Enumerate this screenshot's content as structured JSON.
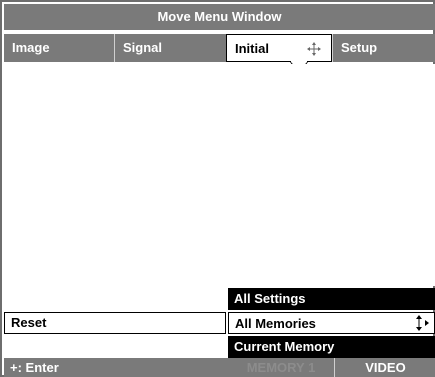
{
  "window": {
    "title": "Move Menu Window"
  },
  "tabs": [
    {
      "label": "Image"
    },
    {
      "label": "Signal"
    },
    {
      "label": "Initial"
    },
    {
      "label": "Setup"
    }
  ],
  "reset": {
    "label": "Reset"
  },
  "dropdown": {
    "options": [
      "All Settings",
      "All Memories",
      "Current Memory"
    ],
    "selected": "All Memories"
  },
  "status": {
    "enter_hint": "+: Enter",
    "memory": "MEMORY 1",
    "source": "VIDEO"
  },
  "colors": {
    "bar": "#7a7a7a",
    "highlight": "#000000",
    "disabled_text": "#8c8c8c"
  }
}
